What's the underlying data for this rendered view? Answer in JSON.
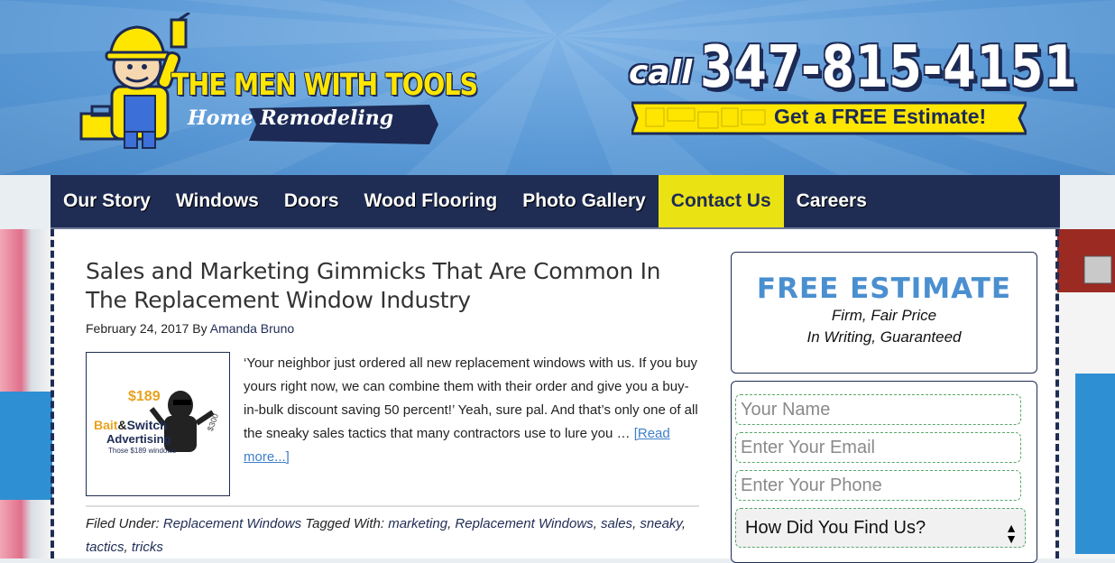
{
  "header": {
    "logo_title": "THE MEN WITH TOOLS",
    "logo_subtitle": "Home Remodeling",
    "call_label": "call",
    "phone": "347-815-4151",
    "estimate_banner": "Get a FREE Estimate!"
  },
  "nav": {
    "items": [
      {
        "label": "Our Story"
      },
      {
        "label": "Windows"
      },
      {
        "label": "Doors"
      },
      {
        "label": "Wood Flooring"
      },
      {
        "label": "Photo Gallery"
      },
      {
        "label": "Contact Us"
      },
      {
        "label": "Careers"
      }
    ]
  },
  "post": {
    "title": "Sales and Marketing Gimmicks That Are Common In The Replacement Window Industry",
    "date": "February 24, 2017",
    "by": "By",
    "author": "Amanda Bruno",
    "excerpt": "‘Your neighbor just ordered all new replacement windows with us. If you buy yours right now, we can combine them with their order and give you a buy-in-bulk discount saving 50 percent!’ Yeah, sure pal. And that’s only one of all the sneaky sales tactics that many contractors use to lure you … ",
    "read_more": "[Read more...]",
    "filed_under_label": "Filed Under:",
    "category": "Replacement Windows",
    "tagged_label": "Tagged With:",
    "tags": [
      "marketing",
      "Replacement Windows",
      "sales",
      "sneaky",
      "tactics",
      "tricks"
    ],
    "thumb": {
      "price": "$189",
      "price2": "$300",
      "line1": "Bait",
      "amp": "&",
      "line1b": "Switch",
      "line2": "Advertising",
      "line3": "Those $189 windows"
    }
  },
  "sidebar": {
    "estimate_title": "FREE ESTIMATE",
    "estimate_line1": "Firm, Fair Price",
    "estimate_line2": "In Writing, Guaranteed",
    "name_placeholder": "Your Name",
    "email_placeholder": "Enter Your Email",
    "phone_placeholder": "Enter Your Phone",
    "source_select": "How Did You Find Us?"
  },
  "colors": {
    "nav_bg": "#1f2d55",
    "nav_active": "#ebe213",
    "header_blue": "#5a99d6",
    "accent_blue": "#4a8fd0"
  }
}
